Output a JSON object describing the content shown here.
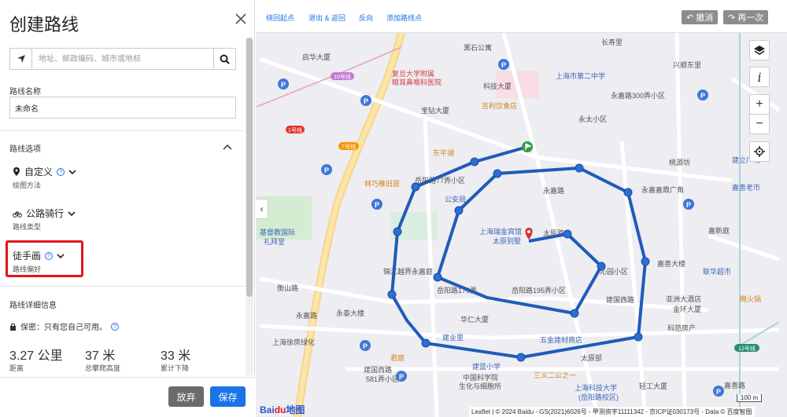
{
  "panel": {
    "title": "创建路线",
    "search_placeholder": "地址、邮政编码、城市或地标",
    "route_name_label": "路线名称",
    "route_name_value": "未命名",
    "options_label": "路线选项",
    "option1": {
      "label": "自定义",
      "sub": "绘图方法"
    },
    "option2": {
      "label": "公路骑行",
      "sub": "路线类型"
    },
    "option3": {
      "label": "徒手画",
      "sub": "路线偏好"
    },
    "details_label": "路线详细信息",
    "privacy": "保密：只有您自己可用。",
    "stats": [
      {
        "value": "3.27 公里",
        "label": "距离"
      },
      {
        "value": "37 米",
        "label": "总攀爬高度"
      },
      {
        "value": "33 米",
        "label": "累计下降"
      }
    ],
    "discard": "放弃",
    "save": "保存"
  },
  "toolbar": {
    "loop": "绕回起点",
    "out_back": "退出 & 返回",
    "reverse": "反向",
    "add_points": "添加路线点",
    "undo": "↶ 撤消",
    "redo": "↷ 再一次"
  },
  "map": {
    "info_icon_text": "i",
    "zoom_in": "+",
    "zoom_out": "−",
    "collapse": "‹",
    "scale": "100 m",
    "attribution": "Leaflet | © 2024 Baidu - GS(2021)6026号 - 甲测资字11111342 - 京ICP证030173号 - Data © 百度智图",
    "logo_a": "Bai",
    "logo_b": "du",
    "logo_c": "地图",
    "labels": {
      "l1": "黑石公寓",
      "l2": "长寿里",
      "l3": "启华大厦",
      "l4": "复旦大学附属",
      "l5": "眼耳鼻喉科医院",
      "l6": "上海市第二中学",
      "l7": "宝钻大厦",
      "l8": "科技大厦",
      "l9": "吉利饮食店",
      "l10": "永嘉路300弄小区",
      "l11": "兴顺东里",
      "l12": "永太小区",
      "l13": "东平湖",
      "l14": "桃源坊",
      "l15": "7号线",
      "l16": "1号线",
      "l17": "10号线",
      "l18": "永嘉路",
      "l19": "林巧稚旧居",
      "l20": "岳阳路77弄小区",
      "l21": "公安局",
      "l22": "永嘉嘉鼎广角",
      "l23": "嘉善老市",
      "l24": "上海瑞金宾馆",
      "l25": "太原别墅",
      "l26": "太原路",
      "l27": "基督教国际",
      "l28": "礼拜堂",
      "l29": "衡山路",
      "l30": "嘉新庭",
      "l31": "联华超市",
      "l32": "锦江越界永嘉庭",
      "l33": "岳阳路170弄",
      "l34": "岳阳路195弄小区",
      "l35": "建国西路",
      "l36": "沁园小区",
      "l37": "嘉善大楼",
      "l38": "永嘉路",
      "l39": "永泰大楼",
      "l40": "华仁大厦",
      "l41": "科范房产",
      "l42": "上海徐房绿化",
      "l43": "建业里",
      "l44": "五金建材商店",
      "l45": "太原部",
      "l46": "君庭",
      "l47": "建国西路",
      "l48": "581弄小区",
      "l49": "建蓝小学",
      "l50": "中国科学院",
      "l51": "生化与细胞所",
      "l52": "三义二公之一",
      "l53": "上海科技大学",
      "l54": "(岳阳路校区)",
      "l55": "轻工大厦",
      "l56": "嘉善路",
      "l57": "12号线",
      "l58": "亚洲大酒店",
      "l59": "椭火锅",
      "l60": "金环大厦",
      "l61": "建立广场"
    }
  }
}
